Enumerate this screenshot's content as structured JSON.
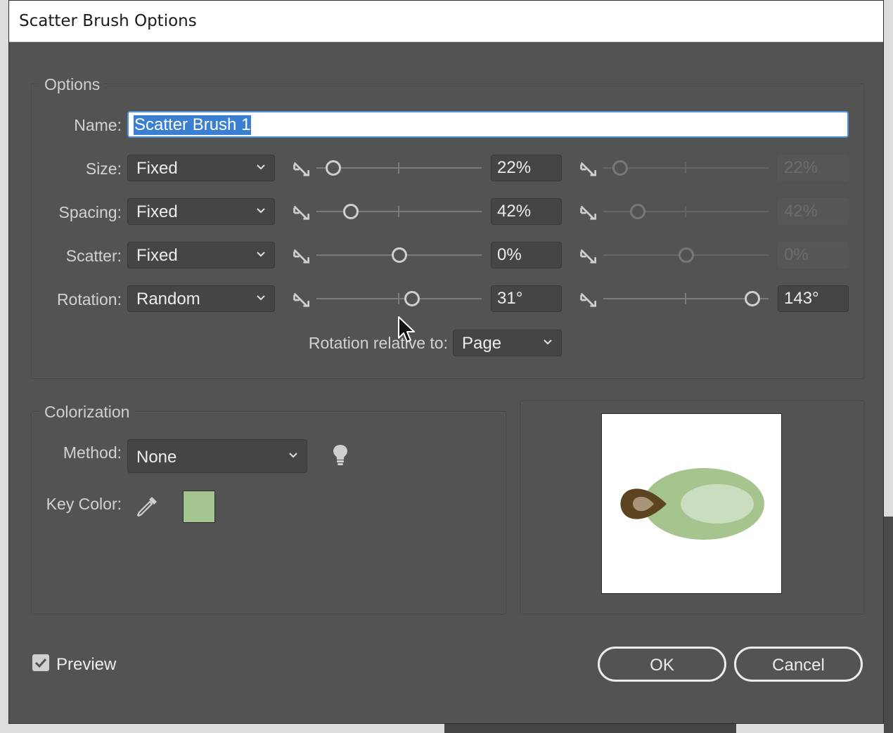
{
  "title": "Scatter Brush Options",
  "options": {
    "legend": "Options",
    "name_label": "Name:",
    "name_value": "Scatter Brush 1",
    "rows": [
      {
        "label": "Size:",
        "mode": "Fixed",
        "min_value": "22%",
        "max_value": "22%",
        "min_level": 0.1,
        "max_level": 0.1
      },
      {
        "label": "Spacing:",
        "mode": "Fixed",
        "min_value": "42%",
        "max_value": "42%",
        "min_level": 0.21,
        "max_level": 0.21
      },
      {
        "label": "Scatter:",
        "mode": "Fixed",
        "min_value": "0%",
        "max_value": "0%",
        "min_level": 0.5,
        "max_level": 0.5
      },
      {
        "label": "Rotation:",
        "mode": "Random",
        "min_value": "31°",
        "max_value": "143°",
        "min_level": 0.58,
        "max_level": 0.9
      }
    ],
    "rotation_relative_label": "Rotation relative to:",
    "rotation_relative_value": "Page"
  },
  "colorization": {
    "legend": "Colorization",
    "method_label": "Method:",
    "method_value": "None",
    "key_color_label": "Key Color:",
    "key_color": "#a4c58f"
  },
  "preview_label": "Preview",
  "preview_checked": true,
  "ok_label": "OK",
  "cancel_label": "Cancel",
  "colors": {
    "dialog_bg": "#535353",
    "selection": "#3a7fd2",
    "leaf_outer": "#a6c48e",
    "leaf_inner": "#cbddbf",
    "seed_outer": "#5c4420",
    "seed_inner": "#a89478"
  }
}
